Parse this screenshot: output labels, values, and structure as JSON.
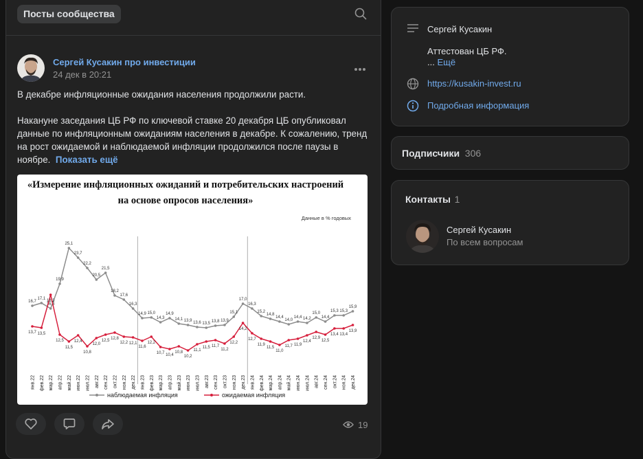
{
  "feed": {
    "title": "Посты сообщества",
    "post": {
      "author": "Сергей Кусакин про инвестиции",
      "date": "24 дек в 20:21",
      "lines": [
        "В декабре инфляционные ожидания населения продолжили расти.",
        "Накануне заседания ЦБ РФ по ключевой ставке 20 декабря ЦБ опубликовал",
        "данные по инфляционным ожиданиям населения в декабре. К сожалению, тренд",
        "на рост ожидаемой и наблюдаемой инфляции продолжился после паузы в",
        "ноябре."
      ],
      "show_more": "Показать ещё",
      "views": "19"
    }
  },
  "chart_data": {
    "type": "line",
    "title_line1": "«Измерение инфляционных ожиданий и потребительских настроений",
    "title_line2": "на основе опросов населения»",
    "unit_note": "Данные в % годовых",
    "categories": [
      "янв.22",
      "фев.22",
      "мар.22",
      "апр.22",
      "май.22",
      "июн.22",
      "июл.22",
      "авг.22",
      "сен.22",
      "окт.22",
      "ноя.22",
      "дек.22",
      "янв.23",
      "фев.23",
      "мар.23",
      "апр.23",
      "май.23",
      "июн.23",
      "июл.23",
      "авг.23",
      "сен.23",
      "окт.23",
      "ноя.23",
      "дек.23",
      "янв.24",
      "фев.24",
      "мар.24",
      "апр.24",
      "май.24",
      "июн.24",
      "июл.24",
      "авг.24",
      "сен.24",
      "окт.24",
      "ноя.24",
      "дек.24"
    ],
    "series": [
      {
        "name": "наблюдаемая инфляция",
        "color": "#8c8c8c",
        "values": [
          16.7,
          17.1,
          16.3,
          19.9,
          25.1,
          23.7,
          22.2,
          20.5,
          21.5,
          18.2,
          17.6,
          16.3,
          14.9,
          15.0,
          14.3,
          14.9,
          14.1,
          13.9,
          13.6,
          13.5,
          13.8,
          13.9,
          15.1,
          17.0,
          16.3,
          15.2,
          14.8,
          14.4,
          14.0,
          14.4,
          14.2,
          15.0,
          14.4,
          15.3,
          15.3,
          15.9
        ]
      },
      {
        "name": "ожидаемая инфляция",
        "color": "#d61f3c",
        "values": [
          13.7,
          13.5,
          18.3,
          12.5,
          11.5,
          12.4,
          10.8,
          12.0,
          12.5,
          12.8,
          12.2,
          12.1,
          11.6,
          12.2,
          10.7,
          10.4,
          10.8,
          10.2,
          11.1,
          11.5,
          11.7,
          11.2,
          12.2,
          14.2,
          12.7,
          11.9,
          11.5,
          11.0,
          11.7,
          11.9,
          12.4,
          12.9,
          12.5,
          13.4,
          13.4,
          13.9
        ]
      }
    ],
    "ylim": [
      8,
      27
    ],
    "legend": "bottom",
    "dividers_after": [
      "дек.22",
      "дек.23"
    ]
  },
  "sidebar": {
    "info": {
      "name": "Сергей Кусакин",
      "desc": "Аттестован ЦБ РФ.",
      "ellipsis": "...",
      "more": "Ещё",
      "link": "https://kusakin-invest.ru",
      "details": "Подробная информация"
    },
    "subscribers": {
      "label": "Подписчики",
      "count": "306"
    },
    "contacts": {
      "label": "Контакты",
      "count": "1",
      "person_name": "Сергей Кусакин",
      "person_role": "По всем вопросам"
    }
  }
}
